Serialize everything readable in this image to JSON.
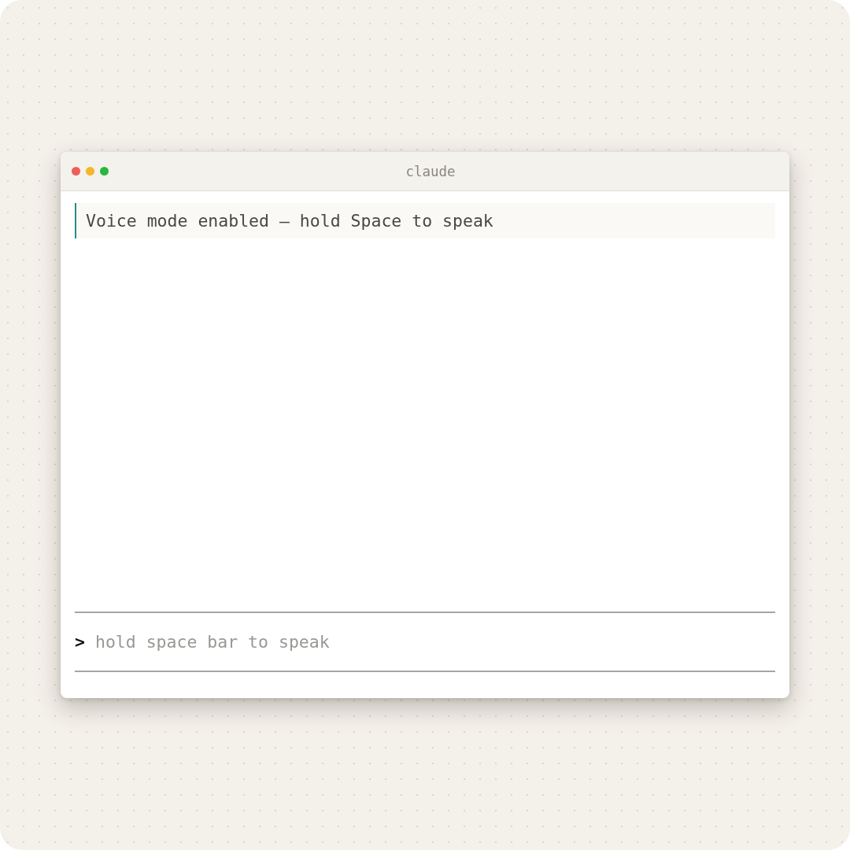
{
  "window": {
    "title": "claude"
  },
  "messages": [
    {
      "kind": "notice",
      "text": "Voice mode enabled — hold Space to speak"
    }
  ],
  "prompt": {
    "symbol": ">",
    "placeholder": "hold space bar to speak"
  }
}
